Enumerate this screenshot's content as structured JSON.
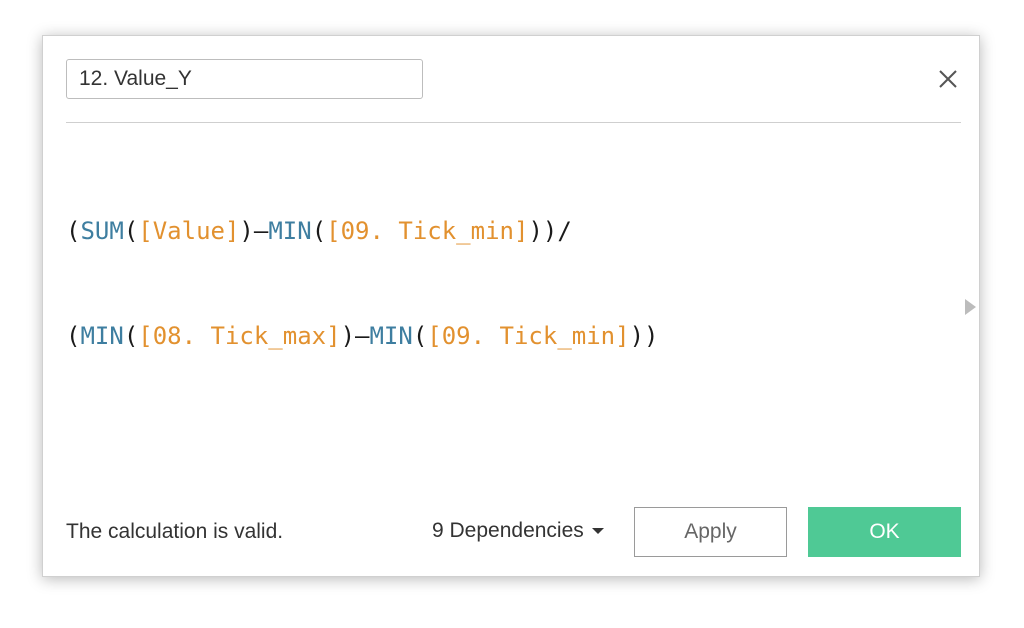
{
  "dialog": {
    "calc_name": "12. Value_Y",
    "close_icon": "close-icon"
  },
  "formula": {
    "line1": [
      {
        "t": "p",
        "v": "("
      },
      {
        "t": "fn",
        "v": "SUM"
      },
      {
        "t": "p",
        "v": "("
      },
      {
        "t": "fld",
        "v": "[Value]"
      },
      {
        "t": "p",
        "v": ")–"
      },
      {
        "t": "fn",
        "v": "MIN"
      },
      {
        "t": "p",
        "v": "("
      },
      {
        "t": "fld",
        "v": "[09. Tick_min]"
      },
      {
        "t": "p",
        "v": "))/"
      }
    ],
    "line2": [
      {
        "t": "p",
        "v": "("
      },
      {
        "t": "fn",
        "v": "MIN"
      },
      {
        "t": "p",
        "v": "("
      },
      {
        "t": "fld",
        "v": "[08. Tick_max]"
      },
      {
        "t": "p",
        "v": ")–"
      },
      {
        "t": "fn",
        "v": "MIN"
      },
      {
        "t": "p",
        "v": "("
      },
      {
        "t": "fld",
        "v": "[09. Tick_min]"
      },
      {
        "t": "p",
        "v": "))"
      }
    ]
  },
  "footer": {
    "status": "The calculation is valid.",
    "dependencies": "9 Dependencies",
    "apply_label": "Apply",
    "ok_label": "OK"
  },
  "colors": {
    "function": "#3e7ea0",
    "field": "#e2912f",
    "ok_button": "#4fc995"
  }
}
